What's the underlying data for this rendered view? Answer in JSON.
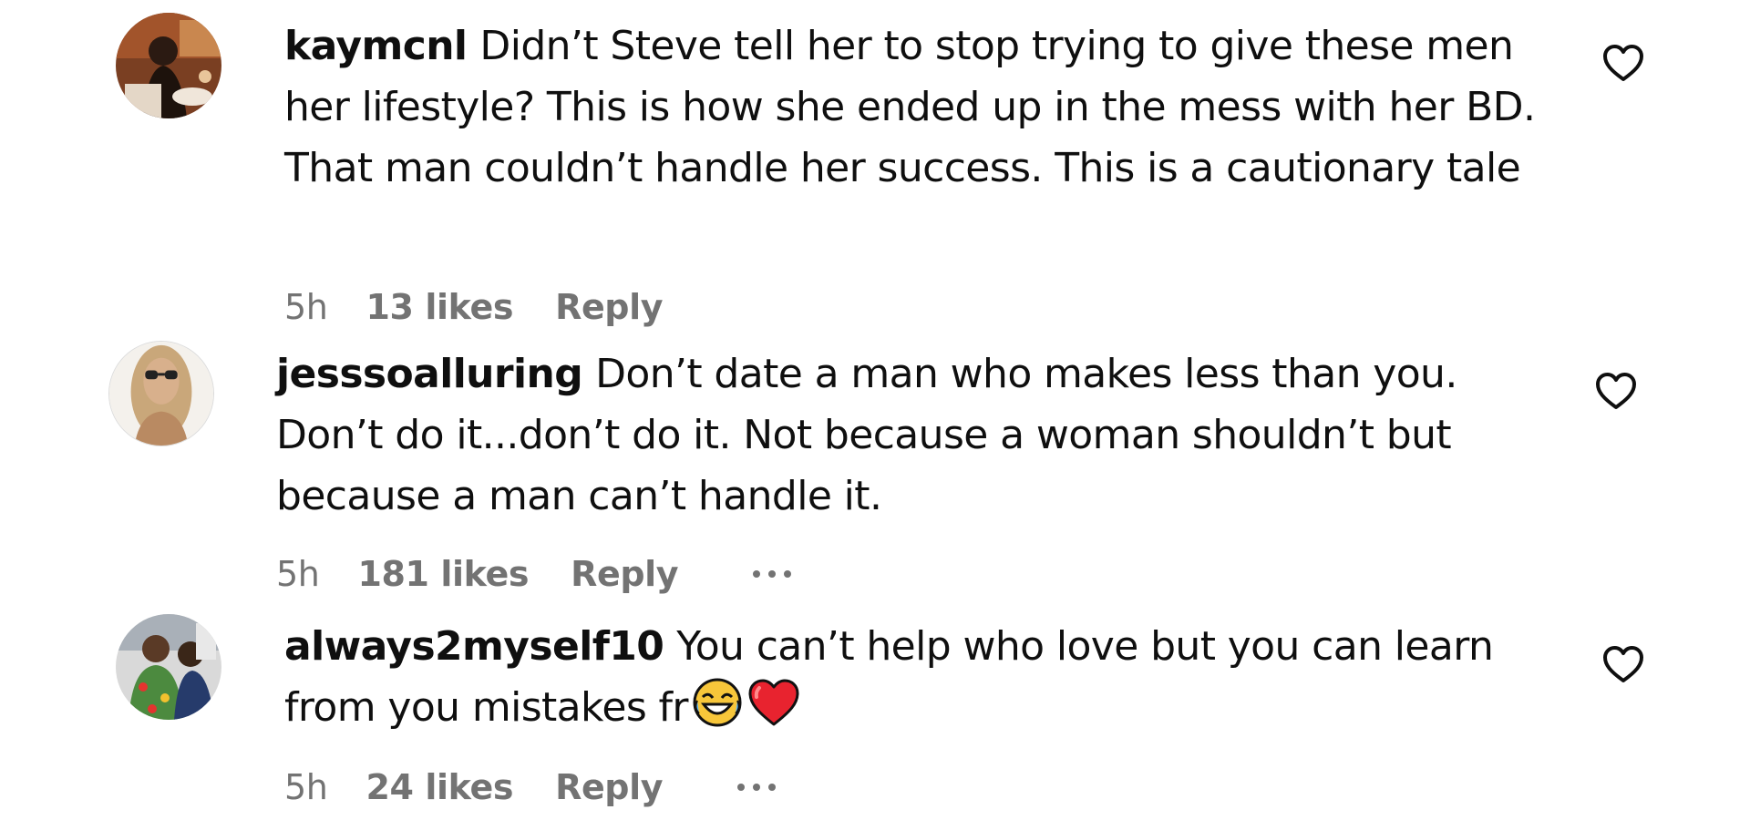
{
  "comments": [
    {
      "username": "kaymcnl",
      "text": "Didn’t Steve tell her to stop trying to give these men her lifestyle? This is how she ended up in the mess with her BD. That man couldn’t handle her success. This is a cautionary tale",
      "time": "5h",
      "likes": "13 likes",
      "reply": "Reply",
      "like_icon": "heart-outline-icon"
    },
    {
      "username": "jesssoalluring",
      "text": "Don’t date a man who makes less than you. Don’t do it...don’t do it. Not because a woman shouldn’t but because a man can’t handle it.",
      "time": "5h",
      "likes": "181 likes",
      "reply": "Reply",
      "more_icon": "more-options-icon",
      "like_icon": "heart-outline-icon"
    },
    {
      "username": "always2myself10",
      "text": "You can’t help who love but you can learn from you mistakes fr",
      "emojis": [
        "face-with-tears-of-joy-emoji",
        "red-heart-emoji"
      ],
      "time": "5h",
      "likes": "24 likes",
      "reply": "Reply",
      "more_icon": "more-options-icon",
      "like_icon": "heart-outline-icon"
    }
  ],
  "colors": {
    "text": "#0f0f0f",
    "meta": "#737373",
    "background": "#ffffff"
  }
}
